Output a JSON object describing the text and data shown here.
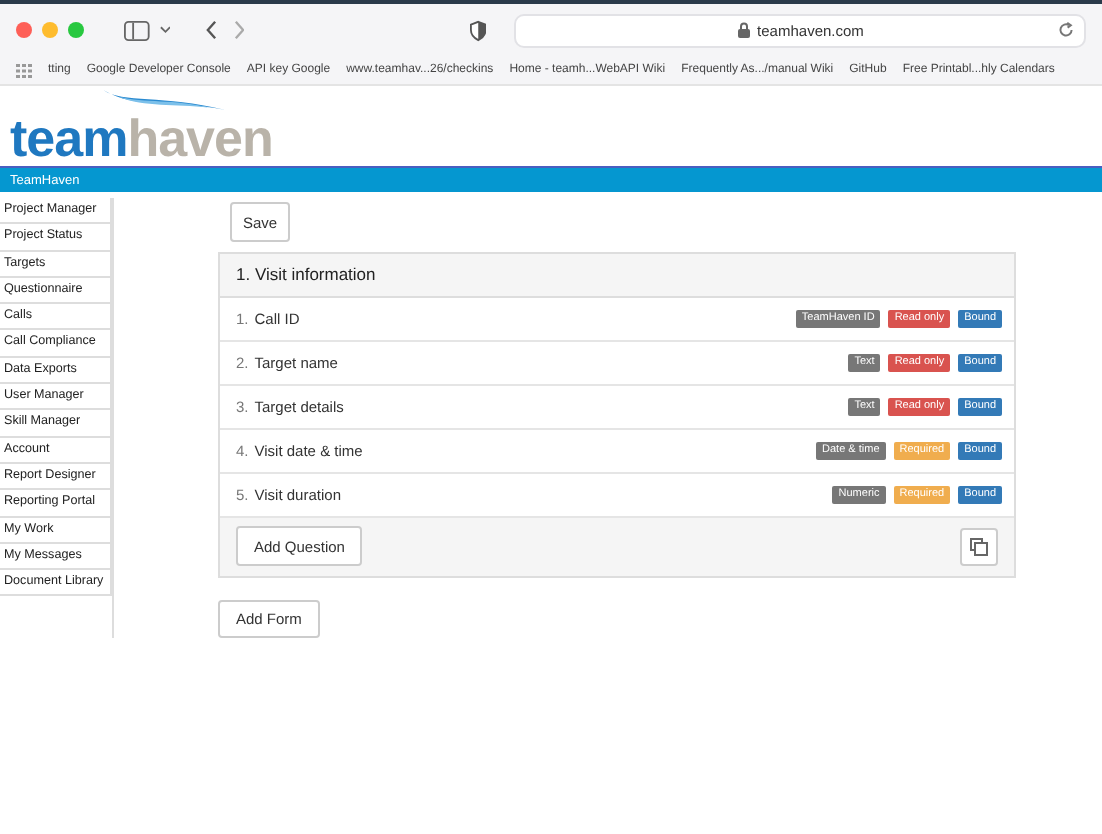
{
  "browser": {
    "address": "teamhaven.com",
    "bookmarks": [
      "tting",
      "Google Developer Console",
      "API key Google",
      "www.teamhav...26/checkins",
      "Home - teamh...WebAPI Wiki",
      "Frequently As.../manual Wiki",
      "GitHub",
      "Free Printabl...hly Calendars"
    ]
  },
  "logo": {
    "part_1": "team",
    "part_2": "haven"
  },
  "navbar": {
    "brand": "TeamHaven"
  },
  "sidebar": {
    "items": [
      {
        "label": "Project Manager"
      },
      {
        "label": "Project Status"
      },
      {
        "label": "Targets"
      },
      {
        "label": "Questionnaire"
      },
      {
        "label": "Calls"
      },
      {
        "label": "Call Compliance"
      },
      {
        "label": "Data Exports"
      },
      {
        "label": "User Manager"
      },
      {
        "label": "Skill Manager"
      },
      {
        "label": "Account"
      },
      {
        "label": "Report Designer"
      },
      {
        "label": "Reporting Portal"
      },
      {
        "label": "My Work"
      },
      {
        "label": "My Messages"
      },
      {
        "label": "Document Library"
      }
    ]
  },
  "save_button": "Save",
  "form": {
    "title": "1. Visit information",
    "questions": [
      {
        "number": "1.",
        "label": "Call ID",
        "badges": [
          {
            "kind": "type",
            "text": "TeamHaven ID"
          },
          {
            "kind": "readonly",
            "text": "Read only"
          },
          {
            "kind": "bound",
            "text": "Bound"
          }
        ]
      },
      {
        "number": "2.",
        "label": "Target name",
        "badges": [
          {
            "kind": "type",
            "text": "Text"
          },
          {
            "kind": "readonly",
            "text": "Read only"
          },
          {
            "kind": "bound",
            "text": "Bound"
          }
        ]
      },
      {
        "number": "3.",
        "label": "Target details",
        "badges": [
          {
            "kind": "type",
            "text": "Text"
          },
          {
            "kind": "readonly",
            "text": "Read only"
          },
          {
            "kind": "bound",
            "text": "Bound"
          }
        ]
      },
      {
        "number": "4.",
        "label": "Visit date & time",
        "badges": [
          {
            "kind": "type",
            "text": "Date & time"
          },
          {
            "kind": "required",
            "text": "Required"
          },
          {
            "kind": "bound",
            "text": "Bound"
          }
        ]
      },
      {
        "number": "5.",
        "label": "Visit duration",
        "badges": [
          {
            "kind": "type",
            "text": "Numeric"
          },
          {
            "kind": "required",
            "text": "Required"
          },
          {
            "kind": "bound",
            "text": "Bound"
          }
        ]
      }
    ],
    "add_question_button": "Add Question"
  },
  "add_form_button": "Add Form"
}
